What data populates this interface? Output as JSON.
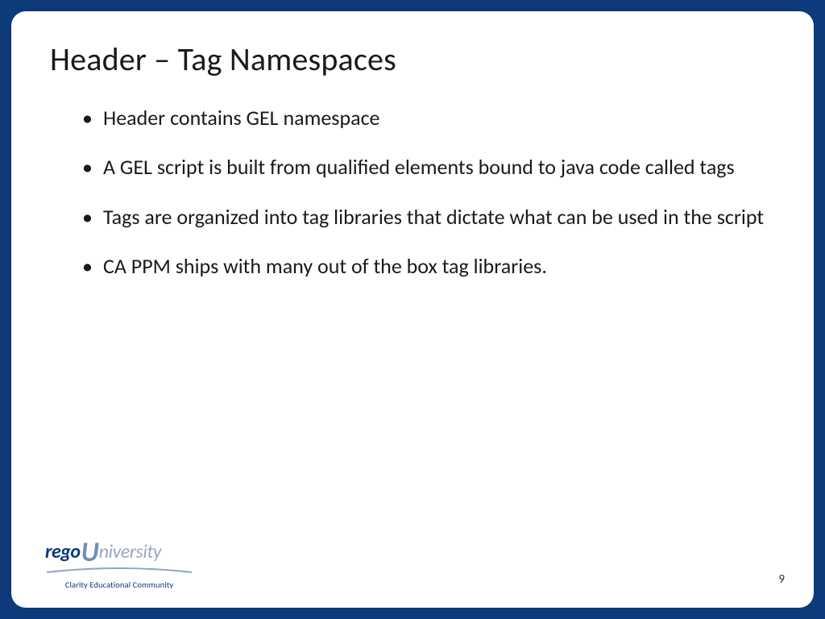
{
  "slide": {
    "title": "Header – Tag Namespaces",
    "bullets": [
      "Header contains GEL namespace",
      "A GEL script is built from qualified elements bound to java code called tags",
      "Tags are organized into tag libraries that dictate what can be used in the script",
      "CA PPM ships with many out of the box tag libraries."
    ],
    "page_number": "9"
  },
  "logo": {
    "part1": "rego",
    "part2": "U",
    "part3": "niversity",
    "tagline": "Clarity Educational Community"
  }
}
